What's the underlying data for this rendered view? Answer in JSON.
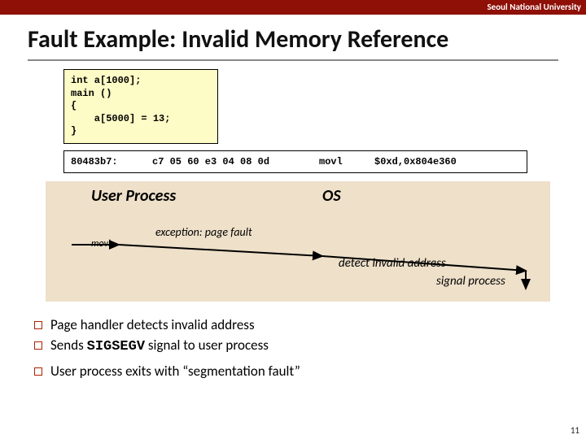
{
  "header": {
    "org": "Seoul National University"
  },
  "title": "Fault Example: Invalid Memory Reference",
  "code": {
    "l1": "int a[1000];",
    "l2": "main ()",
    "l3": "{",
    "l4": "    a[5000] = 13;",
    "l5": "}"
  },
  "asm": {
    "addr": "80483b7:",
    "hex": "c7 05 60 e3 04 08 0d",
    "op": "movl",
    "args": "$0xd,0x804e360"
  },
  "diagram": {
    "user": "User Process",
    "os": "OS",
    "movl": "movl",
    "exception": "exception: page fault",
    "detect": "detect invalid address",
    "signal": "signal process"
  },
  "bullets": {
    "b1": "Page handler detects invalid address",
    "b2_pre": "Sends ",
    "b2_sig": "SIGSEGV",
    "b2_post": " signal to user process",
    "b3": "User process exits with “segmentation fault”"
  },
  "page": "11"
}
